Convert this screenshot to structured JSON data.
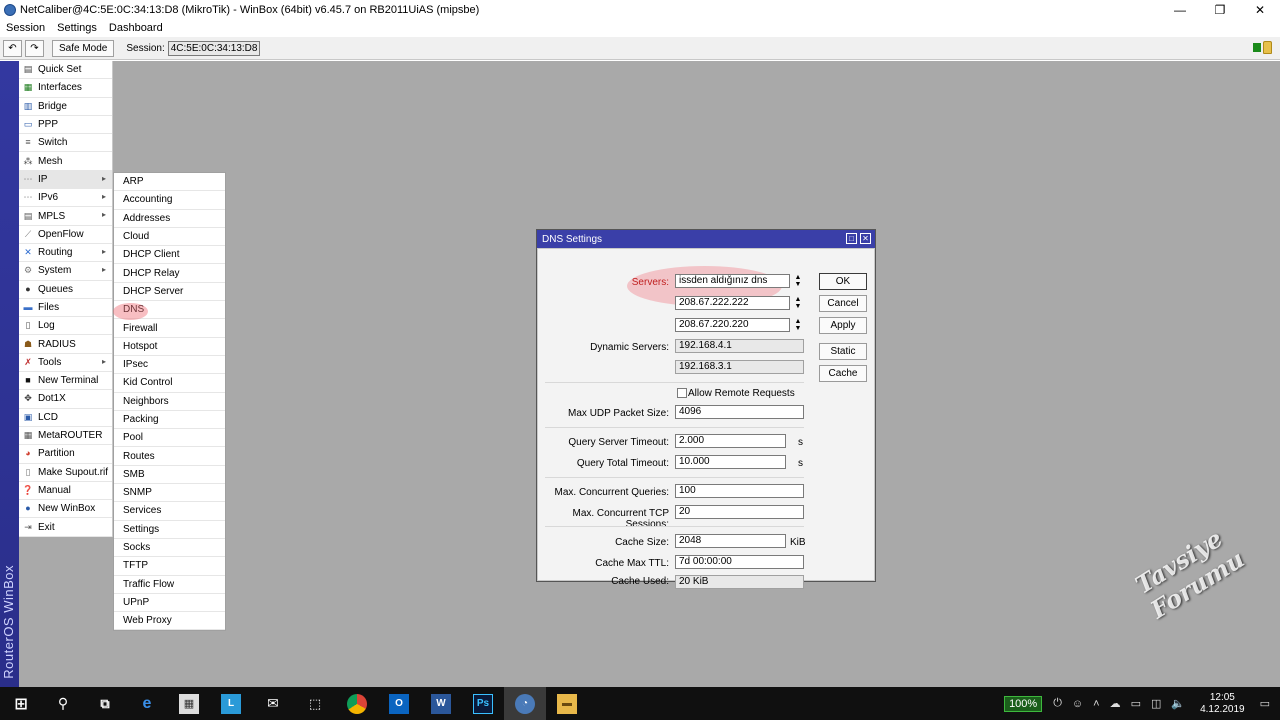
{
  "window": {
    "title": "NetCaliber@4C:5E:0C:34:13:D8 (MikroTik) - WinBox (64bit) v6.45.7 on RB2011UiAS (mipsbe)",
    "minimize": "—",
    "maximize": "❐",
    "close": "✕"
  },
  "menubar": {
    "items": [
      "Session",
      "Settings",
      "Dashboard"
    ]
  },
  "toolbar": {
    "undo": "↶",
    "redo": "↷",
    "safe_mode": "Safe Mode",
    "session_label": "Session:",
    "session_value": "4C:5E:0C:34:13:D8"
  },
  "sidebar": {
    "brand": "RouterOS WinBox",
    "items": [
      {
        "label": "Quick Set",
        "icon": "quick-set-icon"
      },
      {
        "label": "Interfaces",
        "icon": "interfaces-icon"
      },
      {
        "label": "Bridge",
        "icon": "bridge-icon"
      },
      {
        "label": "PPP",
        "icon": "ppp-icon"
      },
      {
        "label": "Switch",
        "icon": "switch-icon"
      },
      {
        "label": "Mesh",
        "icon": "mesh-icon"
      },
      {
        "label": "IP",
        "icon": "ip-icon",
        "submenu": true
      },
      {
        "label": "IPv6",
        "icon": "ipv6-icon",
        "submenu": true
      },
      {
        "label": "MPLS",
        "icon": "mpls-icon",
        "submenu": true
      },
      {
        "label": "OpenFlow",
        "icon": "openflow-icon"
      },
      {
        "label": "Routing",
        "icon": "routing-icon",
        "submenu": true
      },
      {
        "label": "System",
        "icon": "system-icon",
        "submenu": true
      },
      {
        "label": "Queues",
        "icon": "queues-icon"
      },
      {
        "label": "Files",
        "icon": "files-icon"
      },
      {
        "label": "Log",
        "icon": "log-icon"
      },
      {
        "label": "RADIUS",
        "icon": "radius-icon"
      },
      {
        "label": "Tools",
        "icon": "tools-icon",
        "submenu": true
      },
      {
        "label": "New Terminal",
        "icon": "terminal-icon"
      },
      {
        "label": "Dot1X",
        "icon": "dot1x-icon"
      },
      {
        "label": "LCD",
        "icon": "lcd-icon"
      },
      {
        "label": "MetaROUTER",
        "icon": "metarouter-icon"
      },
      {
        "label": "Partition",
        "icon": "partition-icon"
      },
      {
        "label": "Make Supout.rif",
        "icon": "supout-icon"
      },
      {
        "label": "Manual",
        "icon": "manual-icon"
      },
      {
        "label": "New WinBox",
        "icon": "new-winbox-icon"
      },
      {
        "label": "Exit",
        "icon": "exit-icon"
      }
    ]
  },
  "ip_submenu": {
    "items": [
      "ARP",
      "Accounting",
      "Addresses",
      "Cloud",
      "DHCP Client",
      "DHCP Relay",
      "DHCP Server",
      "DNS",
      "Firewall",
      "Hotspot",
      "IPsec",
      "Kid Control",
      "Neighbors",
      "Packing",
      "Pool",
      "Routes",
      "SMB",
      "SNMP",
      "Services",
      "Settings",
      "Socks",
      "TFTP",
      "Traffic Flow",
      "UPnP",
      "Web Proxy"
    ]
  },
  "dns": {
    "title": "DNS Settings",
    "servers_label": "Servers:",
    "servers": [
      "issden aldığınız dns",
      "208.67.222.222",
      "208.67.220.220"
    ],
    "dynamic_servers_label": "Dynamic Servers:",
    "dynamic_servers": [
      "192.168.4.1",
      "192.168.3.1"
    ],
    "allow_remote_requests": "Allow Remote Requests",
    "max_udp_label": "Max UDP Packet Size:",
    "max_udp": "4096",
    "query_server_timeout_label": "Query Server Timeout:",
    "query_server_timeout": "2.000",
    "query_total_timeout_label": "Query Total Timeout:",
    "query_total_timeout": "10.000",
    "unit_s": "s",
    "max_concurrent_queries_label": "Max. Concurrent Queries:",
    "max_concurrent_queries": "100",
    "max_concurrent_tcp_label": "Max. Concurrent TCP Sessions:",
    "max_concurrent_tcp": "20",
    "cache_size_label": "Cache Size:",
    "cache_size": "2048",
    "unit_kib": "KiB",
    "cache_max_ttl_label": "Cache Max TTL:",
    "cache_max_ttl": "7d 00:00:00",
    "cache_used_label": "Cache Used:",
    "cache_used": "20 KiB",
    "buttons": {
      "ok": "OK",
      "cancel": "Cancel",
      "apply": "Apply",
      "static": "Static",
      "cache": "Cache"
    },
    "restore_btn": "□",
    "close_btn": "✕"
  },
  "taskbar": {
    "battery": "100%",
    "time": "12:05",
    "date": "4.12.2019"
  },
  "watermark": "Tavsiye Forumu",
  "colors": {
    "sidebar_blue": "#2f3496",
    "highlight": "#f06e78",
    "workarea": "#a9a9a9"
  }
}
